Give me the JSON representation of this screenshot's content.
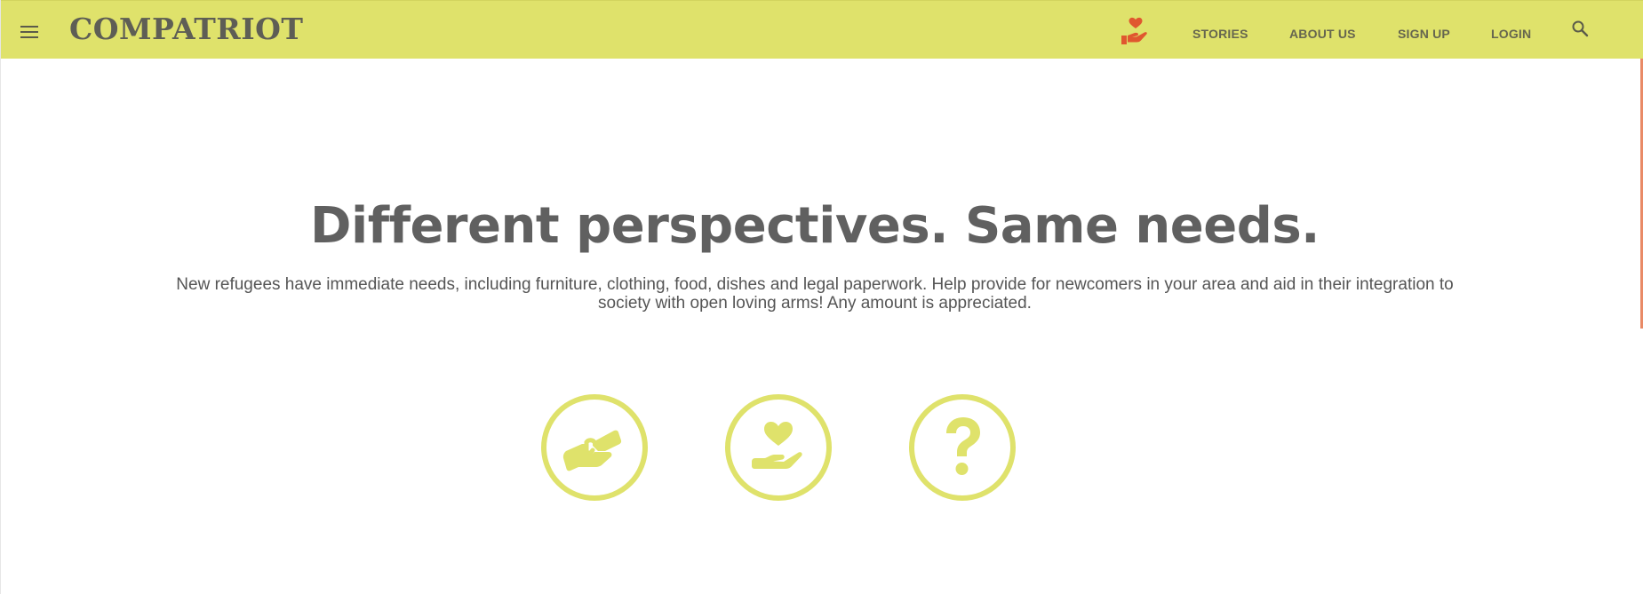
{
  "brand": {
    "name": "COMPATRIOT"
  },
  "nav": {
    "links": [
      {
        "label": "STORIES"
      },
      {
        "label": "ABOUT US"
      },
      {
        "label": "SIGN UP"
      },
      {
        "label": "LOGIN"
      }
    ],
    "donate_icon": "hand-holding-heart-icon",
    "search_icon": "search-icon",
    "menu_icon": "hamburger-menu-icon"
  },
  "hero": {
    "title": "Different perspectives. Same needs.",
    "description": "New refugees have immediate needs, including furniture, clothing, food, dishes and legal paperwork. Help provide for newcomers in your area and aid in their integration to society with open loving arms! Any amount is appreciated."
  },
  "actions": [
    {
      "icon": "handshake-icon"
    },
    {
      "icon": "hand-holding-heart-icon"
    },
    {
      "icon": "question-mark-icon"
    }
  ],
  "colors": {
    "navbar": "#dfe26b",
    "accent": "#dfe26b",
    "donate_icon": "#e0572f",
    "text": "#606060",
    "scroll_accent": "#e98a66"
  }
}
